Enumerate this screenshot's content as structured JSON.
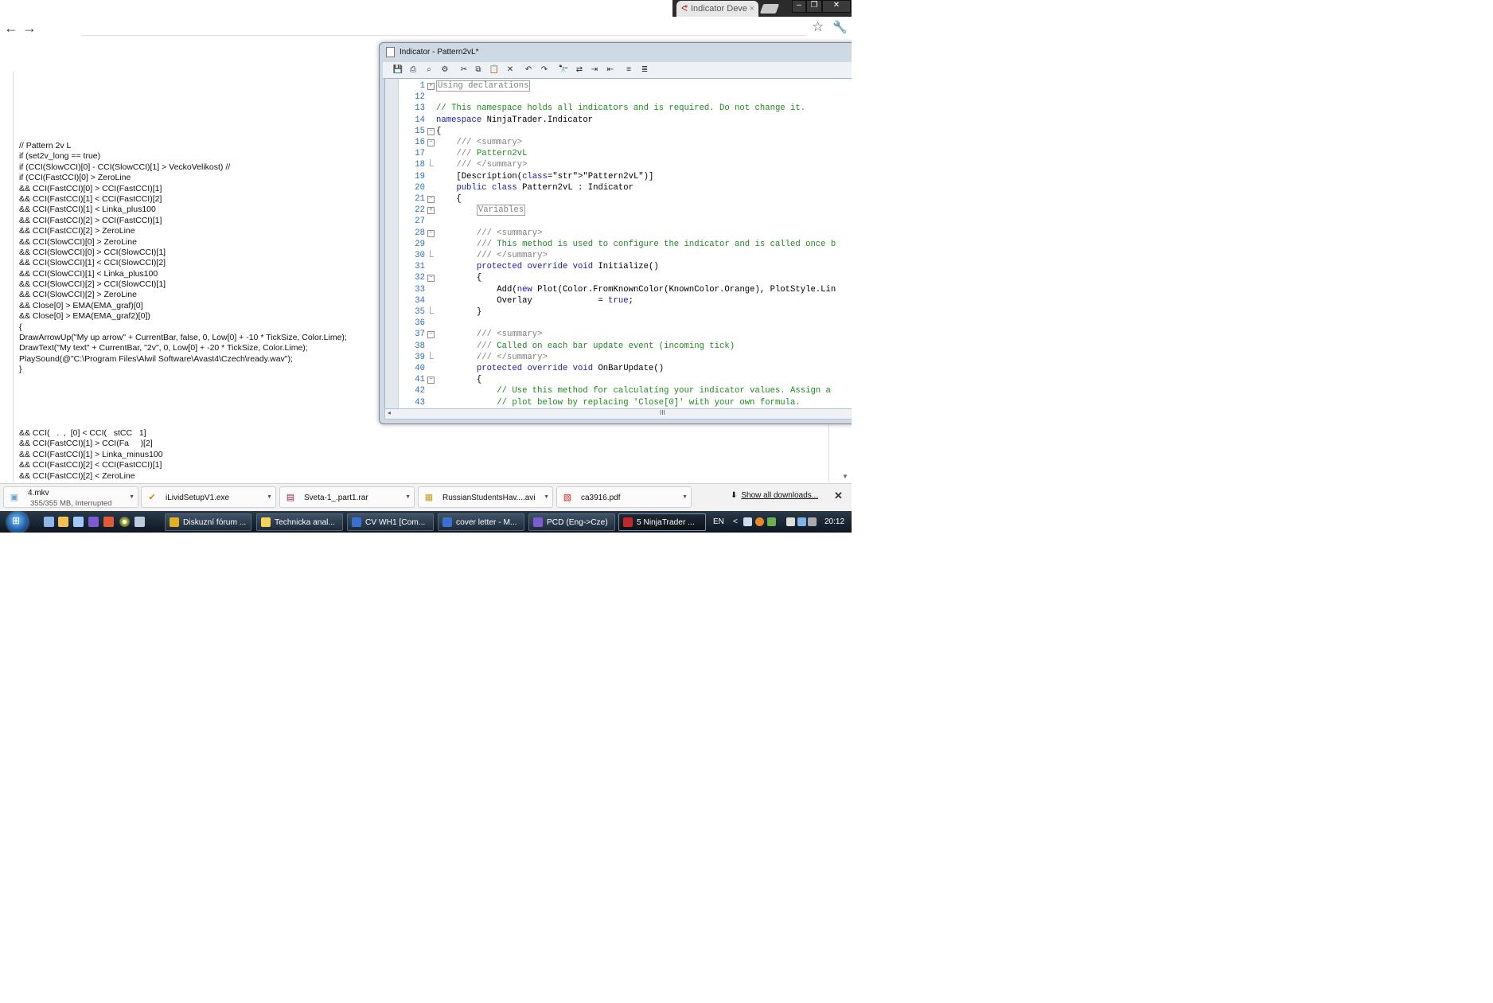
{
  "browser": {
    "tab_title": "Indicator Deve",
    "tab_close": "×",
    "back": "←",
    "forward": "→",
    "star": "☆",
    "wrench": "🔧"
  },
  "page_code": [
    "// Pattern 2v L",
    "if (set2v_long == true)",
    "if (CCI(SlowCCI)[0] - CCI(SlowCCI)[1] > VeckoVelikost) //",
    "if (CCI(FastCCI)[0] > ZeroLine",
    "&& CCI(FastCCI)[0] > CCI(FastCCI)[1]",
    "&& CCI(FastCCI)[1] < CCI(FastCCI)[2]",
    "&& CCI(FastCCI)[1] < Linka_plus100",
    "&& CCI(FastCCI)[2] > CCI(FastCCI)[1]",
    "&& CCI(FastCCI)[2] > ZeroLine",
    "&& CCI(SlowCCI)[0] > ZeroLine",
    "&& CCI(SlowCCI)[0] > CCI(SlowCCI)[1]",
    "&& CCI(SlowCCI)[1] < CCI(SlowCCI)[2]",
    "&& CCI(SlowCCI)[1] < Linka_plus100",
    "&& CCI(SlowCCI)[2] > CCI(SlowCCI)[1]",
    "&& CCI(SlowCCI)[2] > ZeroLine",
    "&& Close[0] > EMA(EMA_graf)[0]",
    "&& Close[0] > EMA(EMA_graf2)[0])",
    "{",
    "DrawArrowUp(\"My up arrow\" + CurrentBar, false, 0, Low[0] + -10 * TickSize, Color.Lime);",
    "DrawText(\"My text\" + CurrentBar, \"2v\", 0, Low[0] + -20 * TickSize, Color.Lime);",
    "PlaySound(@\"C:\\Program Files\\Alwil Software\\Avast4\\Czech\\ready.wav\");",
    "}"
  ],
  "page_code_2": [
    "&& CCI(   .  ,  [0] < CCI(   stCC   1]",
    "&& CCI(FastCCI)[1] > CCI(Fa     )[2]",
    "&& CCI(FastCCI)[1] > Linka_minus100",
    "&& CCI(FastCCI)[2] < CCI(FastCCI)[1]",
    "&& CCI(FastCCI)[2] < ZeroLine"
  ],
  "editor": {
    "title": "Indicator - Pattern2vL*",
    "toolbar_icons": [
      "save-icon",
      "print-icon",
      "print-preview-icon",
      "compile-icon",
      "cut-icon",
      "copy-icon",
      "paste-icon",
      "delete-icon",
      "undo-icon",
      "redo-icon",
      "find-icon",
      "replace-icon",
      "indent-icon",
      "outdent-icon",
      "comment-icon",
      "uncomment-icon"
    ],
    "lines": [
      {
        "n": "1",
        "text": "Using declarations"
      },
      {
        "n": "12",
        "text": ""
      },
      {
        "n": "13",
        "text": "// This namespace holds all indicators and is required. Do not change it."
      },
      {
        "n": "14",
        "text": "namespace NinjaTrader.Indicator"
      },
      {
        "n": "15",
        "text": "{"
      },
      {
        "n": "16",
        "text": "    /// <summary>"
      },
      {
        "n": "17",
        "text": "    /// Pattern2vL"
      },
      {
        "n": "18",
        "text": "    /// </summary>"
      },
      {
        "n": "19",
        "text": "    [Description(\"Pattern2vL\")]"
      },
      {
        "n": "20",
        "text": "    public class Pattern2vL : Indicator"
      },
      {
        "n": "21",
        "text": "    {"
      },
      {
        "n": "22",
        "text": "        Variables"
      },
      {
        "n": "27",
        "text": ""
      },
      {
        "n": "28",
        "text": "        /// <summary>"
      },
      {
        "n": "29",
        "text": "        /// This method is used to configure the indicator and is called once b"
      },
      {
        "n": "30",
        "text": "        /// </summary>"
      },
      {
        "n": "31",
        "text": "        protected override void Initialize()"
      },
      {
        "n": "32",
        "text": "        {"
      },
      {
        "n": "33",
        "text": "            Add(new Plot(Color.FromKnownColor(KnownColor.Orange), PlotStyle.Lin"
      },
      {
        "n": "34",
        "text": "            Overlay             = true;"
      },
      {
        "n": "35",
        "text": "        }"
      },
      {
        "n": "36",
        "text": ""
      },
      {
        "n": "37",
        "text": "        /// <summary>"
      },
      {
        "n": "38",
        "text": "        /// Called on each bar update event (incoming tick)"
      },
      {
        "n": "39",
        "text": "        /// </summary>"
      },
      {
        "n": "40",
        "text": "        protected override void OnBarUpdate()"
      },
      {
        "n": "41",
        "text": "        {"
      },
      {
        "n": "42",
        "text": "            // Use this method for calculating your indicator values. Assign a"
      },
      {
        "n": "43",
        "text": "            // plot below by replacing 'Close[0]' with your own formula."
      }
    ],
    "hscroll_grip": "III"
  },
  "downloads": {
    "items": [
      {
        "name": "4.mkv",
        "status": "355/355 MB, Interrupted",
        "icon": "video-file-icon"
      },
      {
        "name": "iLividSetupV1.exe",
        "status": "",
        "icon": "installer-icon"
      },
      {
        "name": "Sveta-1_.part1.rar",
        "status": "",
        "icon": "rar-archive-icon"
      },
      {
        "name": "RussianStudentsHav....avi",
        "status": "",
        "icon": "avi-file-icon"
      },
      {
        "name": "ca3916.pdf",
        "status": "",
        "icon": "pdf-icon"
      }
    ],
    "show_all": "Show all downloads...",
    "close": "✕"
  },
  "taskbar": {
    "tasks": [
      {
        "label": "Diskuzní fórum ...",
        "icon": "chrome-icon",
        "color": "#e0b020"
      },
      {
        "label": "Technicka anal...",
        "icon": "notepad-icon",
        "color": "#f2d45c"
      },
      {
        "label": "CV WH1 [Com...",
        "icon": "word-icon",
        "color": "#3b6fd1"
      },
      {
        "label": "cover letter - M...",
        "icon": "word-icon",
        "color": "#3b6fd1"
      },
      {
        "label": "PCD (Eng->Cze)",
        "icon": "app-icon",
        "color": "#7d5bd1"
      },
      {
        "label": "5 NinjaTrader ...",
        "icon": "ninjatrader-icon",
        "color": "#c0282d"
      }
    ],
    "lang": "EN",
    "clock": "20:12",
    "chevron": "<"
  }
}
